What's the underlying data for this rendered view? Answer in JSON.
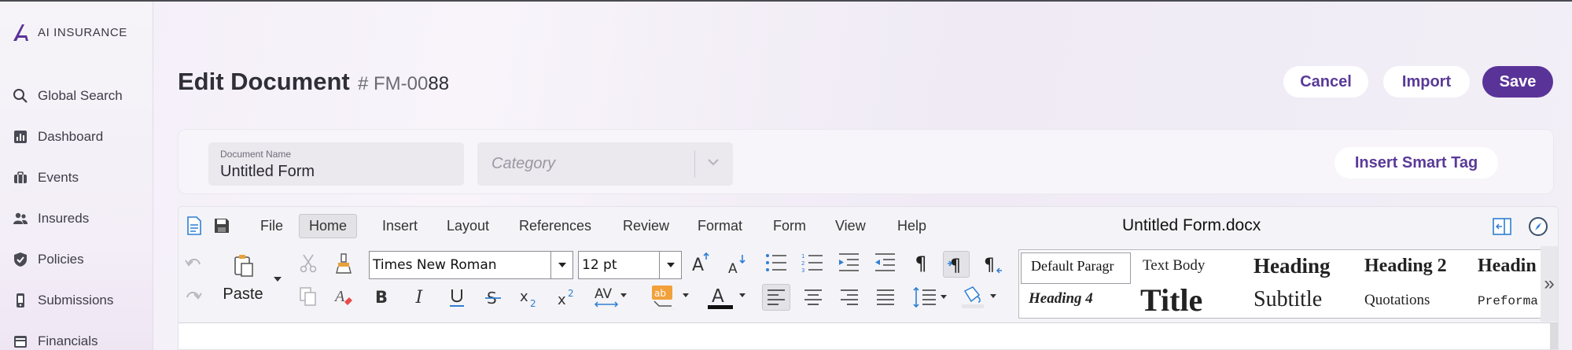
{
  "brand": {
    "name": "AI INSURANCE"
  },
  "sidebar": {
    "items": [
      {
        "label": "Global Search",
        "icon": "search-icon"
      },
      {
        "label": "Dashboard",
        "icon": "chart-icon"
      },
      {
        "label": "Events",
        "icon": "briefcase-icon"
      },
      {
        "label": "Insureds",
        "icon": "users-icon"
      },
      {
        "label": "Policies",
        "icon": "shield-icon"
      },
      {
        "label": "Submissions",
        "icon": "phone-icon"
      },
      {
        "label": "Financials",
        "icon": "wallet-icon"
      }
    ]
  },
  "header": {
    "title": "Edit Document",
    "doc_id_prefix": "# FM-00",
    "doc_id_suffix": "88",
    "cancel_label": "Cancel",
    "import_label": "Import",
    "save_label": "Save"
  },
  "form": {
    "document_name_label": "Document Name",
    "document_name_value": "Untitled Form",
    "category_placeholder": "Category",
    "smart_tag_label": "Insert Smart Tag"
  },
  "editor": {
    "menus": [
      "File",
      "Home",
      "Insert",
      "Layout",
      "References",
      "Review",
      "Format",
      "Form",
      "View",
      "Help"
    ],
    "active_menu": "Home",
    "file_title": "Untitled Form.docx",
    "paste_label": "Paste",
    "font_name": "Times New Roman",
    "font_size": "12 pt",
    "styles": {
      "default_paragraph": "Default Paragr",
      "text_body": "Text Body",
      "heading": "Heading",
      "heading2": "Heading 2",
      "heading_partial": "Headin",
      "heading4": "Heading 4",
      "title": "Title",
      "subtitle": "Subtitle",
      "quotations": "Quotations",
      "preformatted": "Preforma"
    }
  },
  "colors": {
    "accent": "#5a3399",
    "accent_text": "#5a3a98",
    "highlight": "#f2a13a"
  }
}
